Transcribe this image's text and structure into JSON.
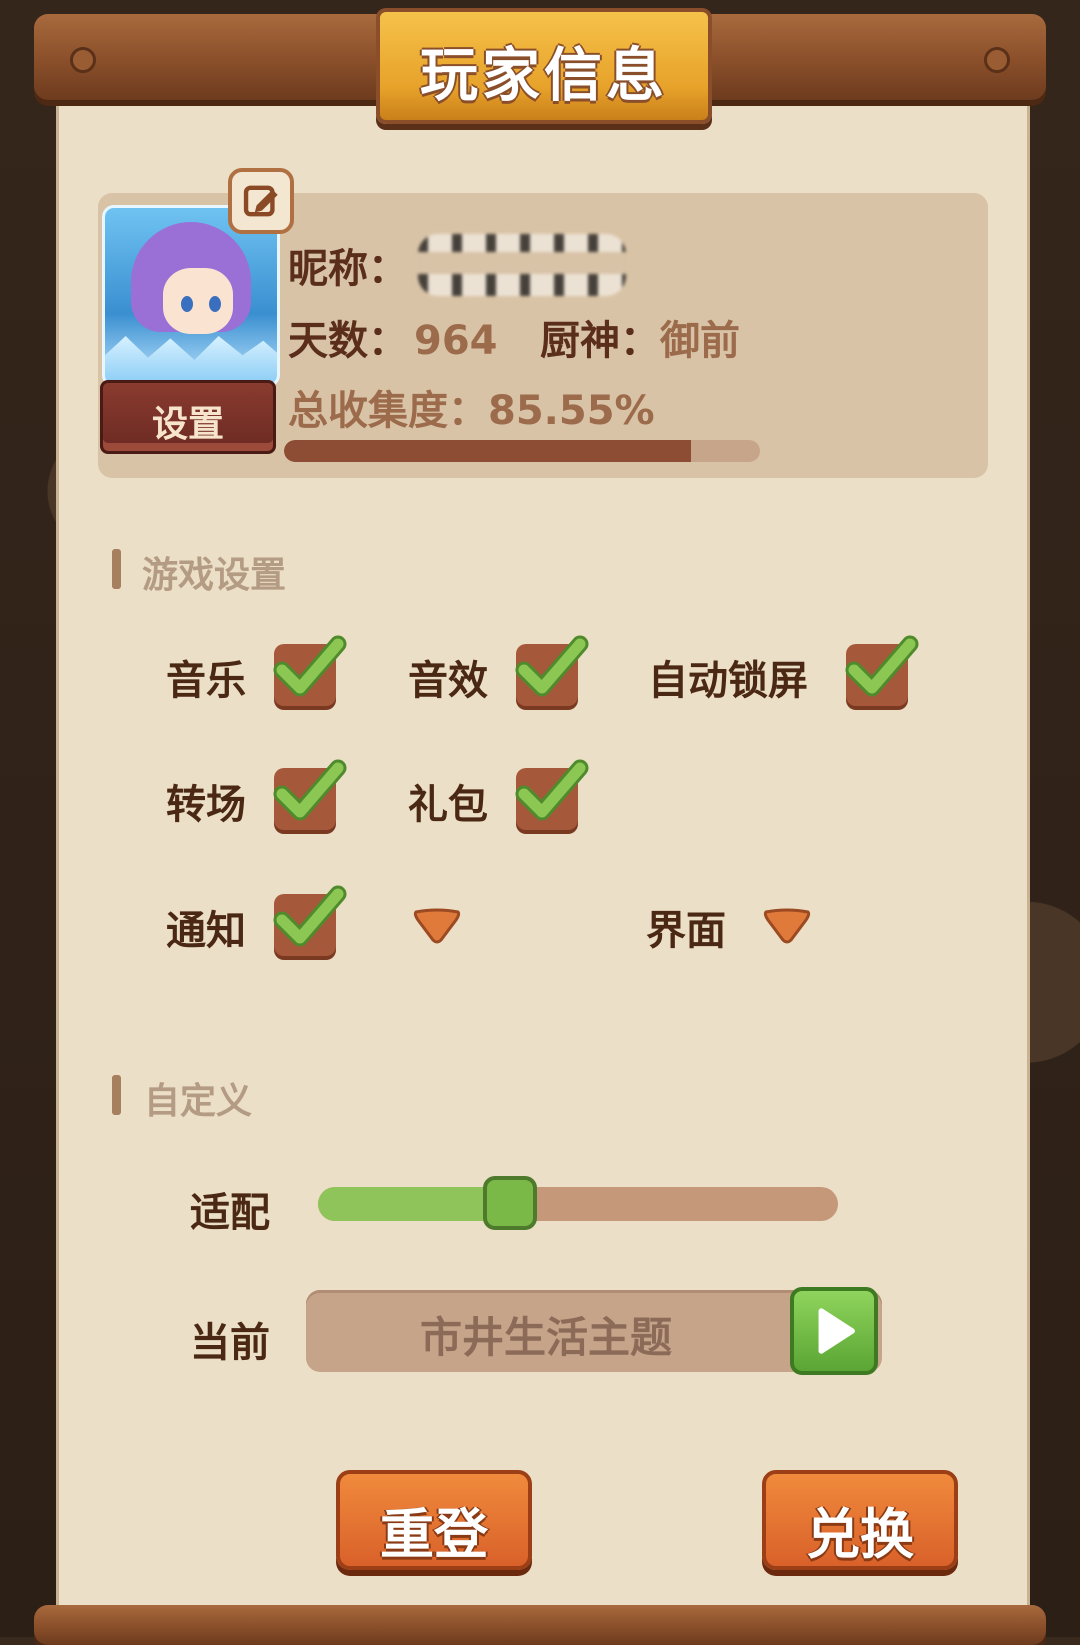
{
  "header": {
    "title": "玩家信息"
  },
  "profile": {
    "avatar_button": "设置",
    "nickname_label": "昵称：",
    "days_label": "天数：",
    "days_value": "964",
    "chef_label": "厨神：",
    "chef_value": "御前",
    "collection_label": "总收集度：",
    "collection_value": "85.55%",
    "collection_progress": 0.8555
  },
  "game_settings": {
    "heading": "游戏设置",
    "options": [
      {
        "label": "音乐",
        "checked": true
      },
      {
        "label": "音效",
        "checked": true
      },
      {
        "label": "自动锁屏",
        "checked": true
      },
      {
        "label": "转场",
        "checked": true
      },
      {
        "label": "礼包",
        "checked": true
      },
      {
        "label": "通知",
        "checked": true
      }
    ],
    "dropdowns": [
      {
        "label": ""
      },
      {
        "label": "界面"
      }
    ]
  },
  "custom": {
    "heading": "自定义",
    "fit_label": "适配",
    "fit_level": 0.37,
    "current_label": "当前",
    "theme_value": "市井生活主题"
  },
  "buttons": {
    "relogin": "重登",
    "redeem": "兑换"
  },
  "colors": {
    "checkbox_green": "#8cc653",
    "accent_orange": "#e8772f",
    "title_gold": "#f2b63c",
    "panel_bg": "#ecdfc7"
  }
}
